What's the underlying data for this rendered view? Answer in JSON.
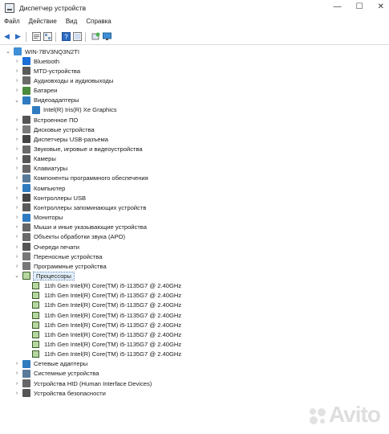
{
  "window": {
    "title": "Диспетчер устройств"
  },
  "menu": [
    "Файл",
    "Действие",
    "Вид",
    "Справка"
  ],
  "tree": {
    "root": "WIN-7BV3NQ3N2TI",
    "rows": [
      {
        "label": "Bluetooth",
        "color": "#1b6fd6"
      },
      {
        "label": "MTD-устройства",
        "color": "#5a5a5a"
      },
      {
        "label": "Аудиовходы и аудиовыходы",
        "color": "#6a6a6a"
      },
      {
        "label": "Батареи",
        "color": "#4b8b3b"
      },
      {
        "label": "Видеоадаптеры",
        "color": "#2f7bbf",
        "expanded": true
      },
      {
        "label": "Intel(R) Iris(R) Xe Graphics",
        "color": "#2f7bbf",
        "child": true
      },
      {
        "label": "Встроенное ПО",
        "color": "#555555"
      },
      {
        "label": "Дисковые устройства",
        "color": "#7a7a7a"
      },
      {
        "label": "Диспетчеры USB-разъема",
        "color": "#444444"
      },
      {
        "label": "Звуковые, игровые и видеоустройства",
        "color": "#6a6a6a"
      },
      {
        "label": "Камеры",
        "color": "#555555"
      },
      {
        "label": "Клавиатуры",
        "color": "#666666"
      },
      {
        "label": "Компоненты программного обеспечения",
        "color": "#5a7a9a"
      },
      {
        "label": "Компьютер",
        "color": "#2f7bbf"
      },
      {
        "label": "Контроллеры USB",
        "color": "#444444"
      },
      {
        "label": "Контроллеры запоминающих устройств",
        "color": "#5a5a5a"
      },
      {
        "label": "Мониторы",
        "color": "#2f7bbf"
      },
      {
        "label": "Мыши и иные указывающие устройства",
        "color": "#666666"
      },
      {
        "label": "Объекты обработки звука (APO)",
        "color": "#6a6a6a"
      },
      {
        "label": "Очереди печати",
        "color": "#555555"
      },
      {
        "label": "Переносные устройства",
        "color": "#777777"
      },
      {
        "label": "Программные устройства",
        "color": "#777777"
      },
      {
        "label": "Процессоры",
        "color": "#3a5a2a",
        "expanded": true,
        "selected": true
      },
      {
        "label": "11th Gen Intel(R) Core(TM) i5-1135G7 @ 2.40GHz",
        "cpu": true,
        "child": true
      },
      {
        "label": "11th Gen Intel(R) Core(TM) i5-1135G7 @ 2.40GHz",
        "cpu": true,
        "child": true
      },
      {
        "label": "11th Gen Intel(R) Core(TM) i5-1135G7 @ 2.40GHz",
        "cpu": true,
        "child": true
      },
      {
        "label": "11th Gen Intel(R) Core(TM) i5-1135G7 @ 2.40GHz",
        "cpu": true,
        "child": true
      },
      {
        "label": "11th Gen Intel(R) Core(TM) i5-1135G7 @ 2.40GHz",
        "cpu": true,
        "child": true
      },
      {
        "label": "11th Gen Intel(R) Core(TM) i5-1135G7 @ 2.40GHz",
        "cpu": true,
        "child": true
      },
      {
        "label": "11th Gen Intel(R) Core(TM) i5-1135G7 @ 2.40GHz",
        "cpu": true,
        "child": true
      },
      {
        "label": "11th Gen Intel(R) Core(TM) i5-1135G7 @ 2.40GHz",
        "cpu": true,
        "child": true
      },
      {
        "label": "Сетевые адаптеры",
        "color": "#2f7bbf"
      },
      {
        "label": "Системные устройства",
        "color": "#5a7a9a"
      },
      {
        "label": "Устройства HID (Human Interface Devices)",
        "color": "#666666"
      },
      {
        "label": "Устройства безопасности",
        "color": "#555555"
      }
    ]
  },
  "watermark": "Avito"
}
